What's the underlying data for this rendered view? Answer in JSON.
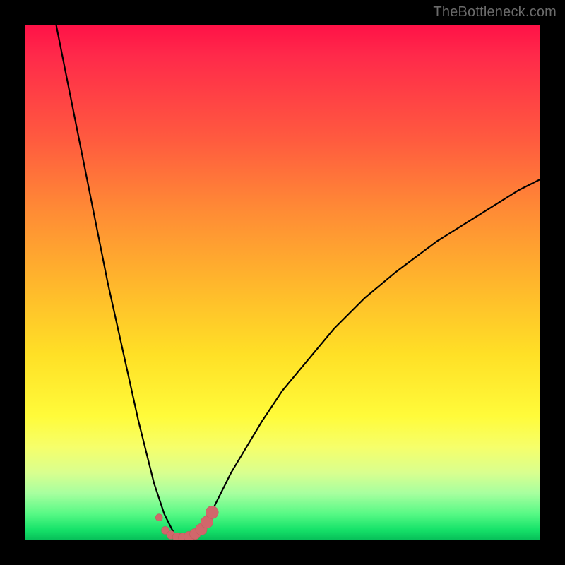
{
  "watermark": {
    "text": "TheBottleneck.com"
  },
  "colors": {
    "curve": "#000000",
    "marker_fill": "#d1676b",
    "marker_stroke": "#c35a5f"
  },
  "chart_data": {
    "type": "line",
    "title": "",
    "xlabel": "",
    "ylabel": "",
    "xlim": [
      0,
      100
    ],
    "ylim": [
      0,
      100
    ],
    "grid": false,
    "legend": false,
    "series": [
      {
        "name": "left-branch",
        "x": [
          6,
          8,
          10,
          12,
          14,
          16,
          18,
          20,
          22,
          24,
          25,
          26,
          27,
          28,
          29
        ],
        "y": [
          100,
          90,
          80,
          70,
          60,
          50,
          41,
          32,
          23,
          15,
          11,
          8,
          5,
          3,
          1
        ]
      },
      {
        "name": "right-branch",
        "x": [
          34,
          35,
          36,
          38,
          40,
          43,
          46,
          50,
          55,
          60,
          66,
          72,
          80,
          88,
          96,
          100
        ],
        "y": [
          1,
          3,
          5,
          9,
          13,
          18,
          23,
          29,
          35,
          41,
          47,
          52,
          58,
          63,
          68,
          70
        ]
      }
    ],
    "markers": {
      "name": "bottom-dots",
      "points": [
        {
          "x": 26.0,
          "y": 4.3
        },
        {
          "x": 27.2,
          "y": 1.8
        },
        {
          "x": 28.3,
          "y": 0.9
        },
        {
          "x": 29.5,
          "y": 0.5
        },
        {
          "x": 30.7,
          "y": 0.4
        },
        {
          "x": 31.8,
          "y": 0.6
        },
        {
          "x": 33.0,
          "y": 1.1
        },
        {
          "x": 34.2,
          "y": 2.0
        },
        {
          "x": 35.3,
          "y": 3.4
        },
        {
          "x": 36.3,
          "y": 5.3
        }
      ],
      "radius_start": 5,
      "radius_end": 9
    }
  }
}
